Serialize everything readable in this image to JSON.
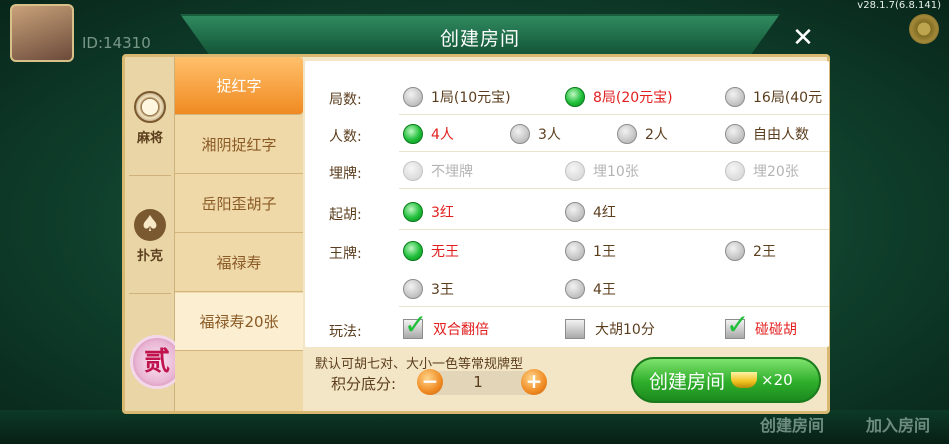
{
  "lobby": {
    "player_id": "ID:14310",
    "version": "v28.1.7(6.8.141)",
    "bottom_create": "创建房间",
    "bottom_join": "加入房间"
  },
  "dialog": {
    "title": "创建房间",
    "close": "✕"
  },
  "categories": [
    {
      "label": "麻将",
      "icon": "mahjong-tile-icon"
    },
    {
      "label": "扑克",
      "icon": "spade-icon"
    },
    {
      "label": "贰",
      "icon": "two-badge-icon"
    }
  ],
  "tabs": [
    {
      "label": "捉红字",
      "active": true
    },
    {
      "label": "湘阴捉红字"
    },
    {
      "label": "岳阳歪胡子"
    },
    {
      "label": "福禄寿"
    },
    {
      "label": "福禄寿20张"
    }
  ],
  "rows": {
    "rounds": {
      "label": "局数:",
      "options": [
        "1局(10元宝)",
        "8局(20元宝)",
        "16局(40元"
      ],
      "selected": "8局(20元宝)"
    },
    "players": {
      "label": "人数:",
      "options": [
        "4人",
        "3人",
        "2人",
        "自由人数"
      ],
      "selected": "4人"
    },
    "bury": {
      "label": "埋牌:",
      "options": [
        "不埋牌",
        "埋10张",
        "埋20张"
      ]
    },
    "start_hu": {
      "label": "起胡:",
      "options": [
        "3红",
        "4红"
      ],
      "selected": "3红"
    },
    "king": {
      "label": "王牌:",
      "options": [
        "无王",
        "1王",
        "2王",
        "3王",
        "4王"
      ],
      "selected": "无王"
    },
    "play": {
      "label": "玩法:",
      "options": [
        "双合翻倍",
        "大胡10分",
        "碰碰胡"
      ],
      "checked": [
        "双合翻倍",
        "碰碰胡"
      ]
    }
  },
  "footer": {
    "note": "默认可胡七对、大小一色等常规牌型",
    "score_label": "积分底分:",
    "score_value": "1",
    "minus": "−",
    "plus": "+",
    "create_label": "创建房间",
    "cost": "×20"
  },
  "colors": {
    "accent_orange": "#f08a22",
    "selected_red": "#e21f1f",
    "create_green": "#2fae2b"
  }
}
